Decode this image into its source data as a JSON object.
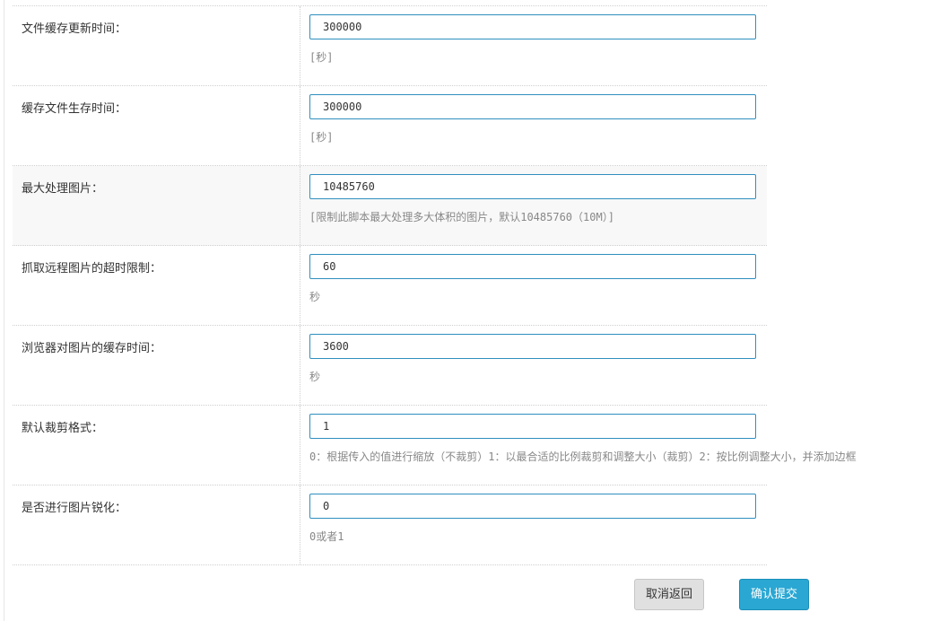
{
  "form": {
    "rows": [
      {
        "label": "文件缓存更新时间：",
        "value": "300000",
        "hint": "[秒]"
      },
      {
        "label": "缓存文件生存时间：",
        "value": "300000",
        "hint": "[秒]"
      },
      {
        "label": "最大处理图片：",
        "value": "10485760",
        "hint": "[限制此脚本最大处理多大体积的图片，默认10485760（10M）]"
      },
      {
        "label": "抓取远程图片的超时限制：",
        "value": "60",
        "hint": "秒"
      },
      {
        "label": "浏览器对图片的缓存时间：",
        "value": "3600",
        "hint": "秒"
      },
      {
        "label": "默认裁剪格式：",
        "value": "1",
        "hint": "0：根据传入的值进行缩放（不裁剪）1：以最合适的比例裁剪和调整大小（裁剪）2：按比例调整大小，并添加边框"
      },
      {
        "label": "是否进行图片锐化：",
        "value": "0",
        "hint": "0或者1"
      }
    ]
  },
  "footer": {
    "cancel_label": "取消返回",
    "submit_label": "确认提交"
  },
  "colors": {
    "accent": "#2aa7d3",
    "input_border": "#2f8fbf"
  }
}
